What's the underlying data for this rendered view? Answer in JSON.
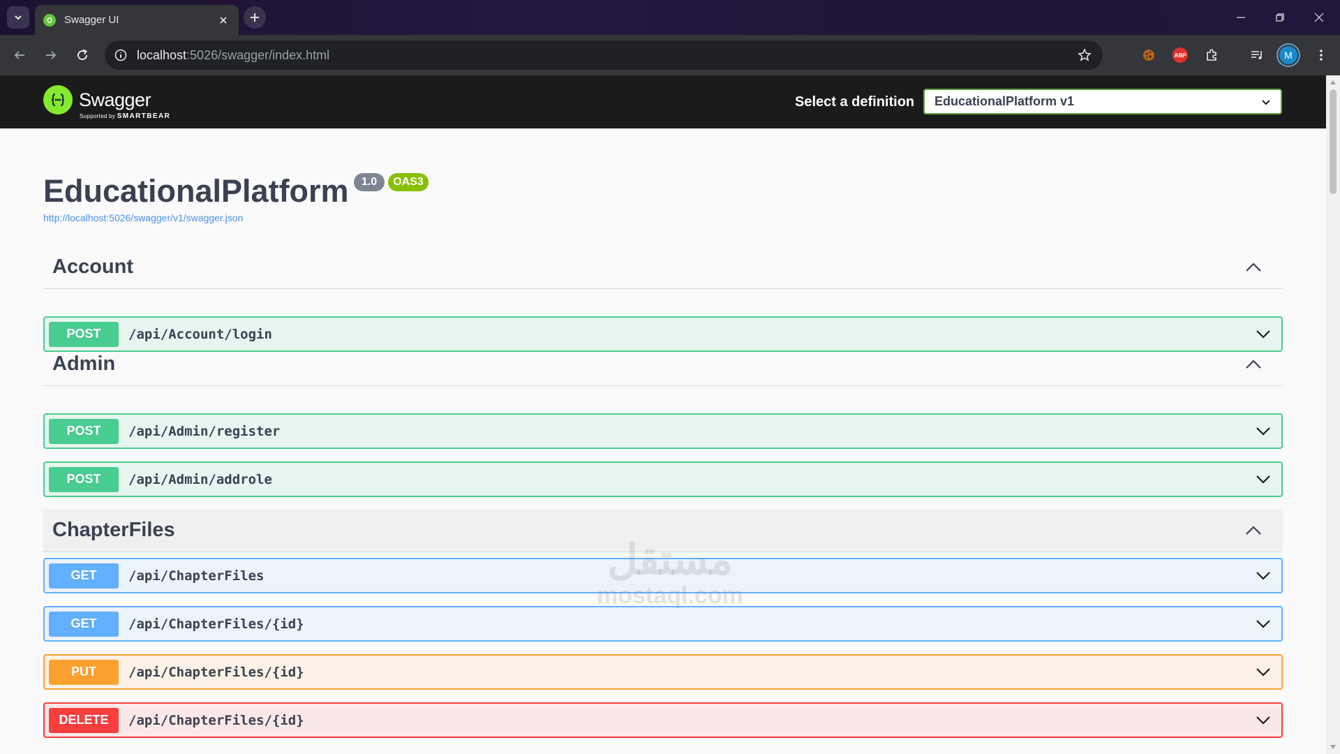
{
  "browser": {
    "tab_title": "Swagger UI",
    "url_host": "localhost",
    "url_rest": ":5026/swagger/index.html",
    "profile_initial": "M",
    "adblock_label": "ABP"
  },
  "swagger": {
    "logo_text": "Swagger",
    "logo_sub_prefix": "Supported by",
    "logo_sub_brand": "SMARTBEAR",
    "select_label": "Select a definition",
    "select_value": "EducationalPlatform v1"
  },
  "info": {
    "title": "EducationalPlatform",
    "version": "1.0",
    "oas": "OAS3",
    "spec_url": "http://localhost:5026/swagger/v1/swagger.json"
  },
  "sections": [
    {
      "name": "Account",
      "operations": [
        {
          "method": "POST",
          "path": "/api/Account/login"
        }
      ]
    },
    {
      "name": "Admin",
      "operations": [
        {
          "method": "POST",
          "path": "/api/Admin/register"
        },
        {
          "method": "POST",
          "path": "/api/Admin/addrole"
        }
      ]
    },
    {
      "name": "ChapterFiles",
      "operations": [
        {
          "method": "GET",
          "path": "/api/ChapterFiles"
        },
        {
          "method": "GET",
          "path": "/api/ChapterFiles/{id}"
        },
        {
          "method": "PUT",
          "path": "/api/ChapterFiles/{id}"
        },
        {
          "method": "DELETE",
          "path": "/api/ChapterFiles/{id}"
        }
      ]
    }
  ],
  "watermark": {
    "arabic": "مستقل",
    "latin": "mostaql.com"
  },
  "colors": {
    "post": "#49cc90",
    "get": "#61affe",
    "put": "#fca130",
    "delete": "#f93e3e",
    "swagger_green": "#85ea2d"
  }
}
